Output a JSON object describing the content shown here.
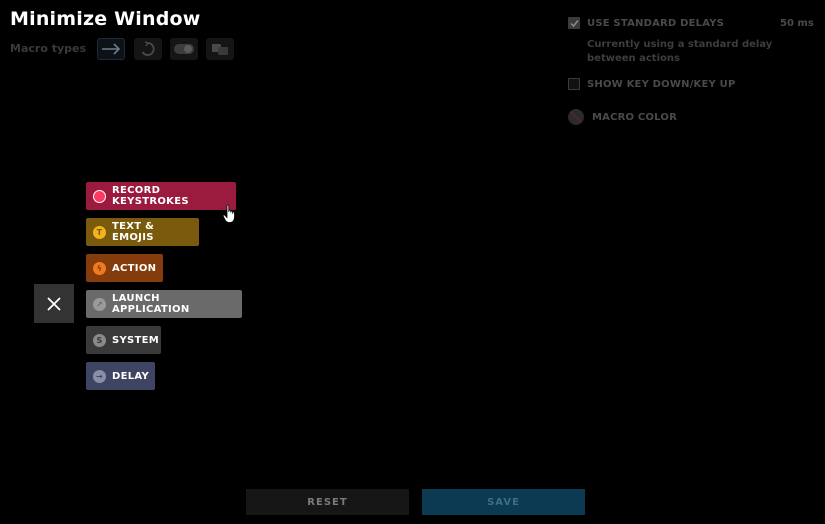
{
  "header": {
    "title": "Minimize Window"
  },
  "macro_types": {
    "label": "Macro types",
    "options": [
      {
        "icon": "arrow-right-icon",
        "selected": true
      },
      {
        "icon": "repeat-icon",
        "selected": false
      },
      {
        "icon": "toggle-icon",
        "selected": false
      },
      {
        "icon": "sequence-icon",
        "selected": false
      }
    ]
  },
  "settings": {
    "standard_delays": {
      "label": "USE STANDARD DELAYS",
      "value": "50 ms",
      "checked": true,
      "description": "Currently using a standard delay between actions"
    },
    "key_down_up": {
      "label": "SHOW KEY DOWN/KEY UP",
      "checked": false
    },
    "macro_color": {
      "label": "MACRO COLOR"
    }
  },
  "menu": {
    "items": [
      {
        "label": "RECORD KEYSTROKES",
        "color": "#9b1b3f",
        "icon_color": "#ff3b63",
        "icon_glyph": ""
      },
      {
        "label": "TEXT & EMOJIS",
        "color": "#7a5a0c",
        "icon_color": "#f2b418",
        "icon_glyph": "T"
      },
      {
        "label": "ACTION",
        "color": "#843c0c",
        "icon_color": "#f07a1e",
        "icon_glyph": "ϟ"
      },
      {
        "label": "LAUNCH APPLICATION",
        "color": "#6a6a6a",
        "icon_color": "#9a9a9a",
        "icon_glyph": "↗"
      },
      {
        "label": "SYSTEM",
        "color": "#3a3a3a",
        "icon_color": "#8a8a8a",
        "icon_glyph": "S"
      },
      {
        "label": "DELAY",
        "color": "#3f4463",
        "icon_color": "#8a8fa8",
        "icon_glyph": "→"
      }
    ]
  },
  "footer": {
    "reset_label": "RESET",
    "save_label": "SAVE"
  },
  "colors": {
    "reset_bg": "#161616",
    "save_bg": "#0b3a52"
  }
}
